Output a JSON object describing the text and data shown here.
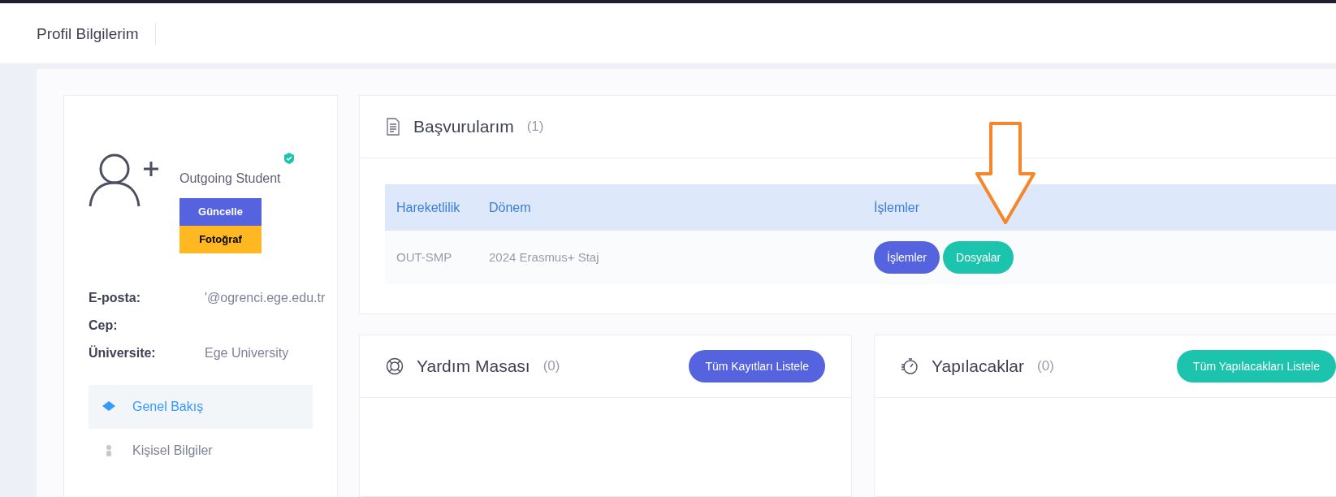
{
  "page_title": "Profil Bilgilerim",
  "profile": {
    "role": "Outgoing Student",
    "verified": true,
    "buttons": [
      {
        "label": "Güncelle",
        "kind": "primary"
      },
      {
        "label": "Fotoğraf",
        "kind": "warning"
      }
    ],
    "fields": [
      {
        "label": "E-posta:",
        "value": "'@ogrenci.ege.edu.tr"
      },
      {
        "label": "Cep:"
      },
      {
        "label": "Üniversite:",
        "value": "Ege University"
      }
    ],
    "nav": [
      {
        "label": "Genel Bakış",
        "selected": true
      },
      {
        "label": "Kişisel Bilgiler",
        "selected": false
      }
    ]
  },
  "applications": {
    "title": "Başvurularım",
    "count": "(1)",
    "columns": [
      "Hareketlilik",
      "Dönem",
      "İşlemler"
    ],
    "rows": [
      {
        "cells": [
          "OUT-SMP",
          "2024 Erasmus+ Staj"
        ],
        "actions": [
          {
            "label": "İşlemler",
            "kind": "primary"
          },
          {
            "label": "Dosyalar",
            "kind": "success"
          }
        ]
      }
    ]
  },
  "helpdesk": {
    "title": "Yardım Masası",
    "count": "(0)",
    "button": {
      "label": "Tüm Kayıtları Listele",
      "kind": "primary"
    }
  },
  "todos": {
    "title": "Yapılacaklar",
    "count": "(0)",
    "button": {
      "label": "Tüm Yapılacakları Listele",
      "kind": "success"
    }
  },
  "annotation": {
    "kind": "arrow"
  }
}
